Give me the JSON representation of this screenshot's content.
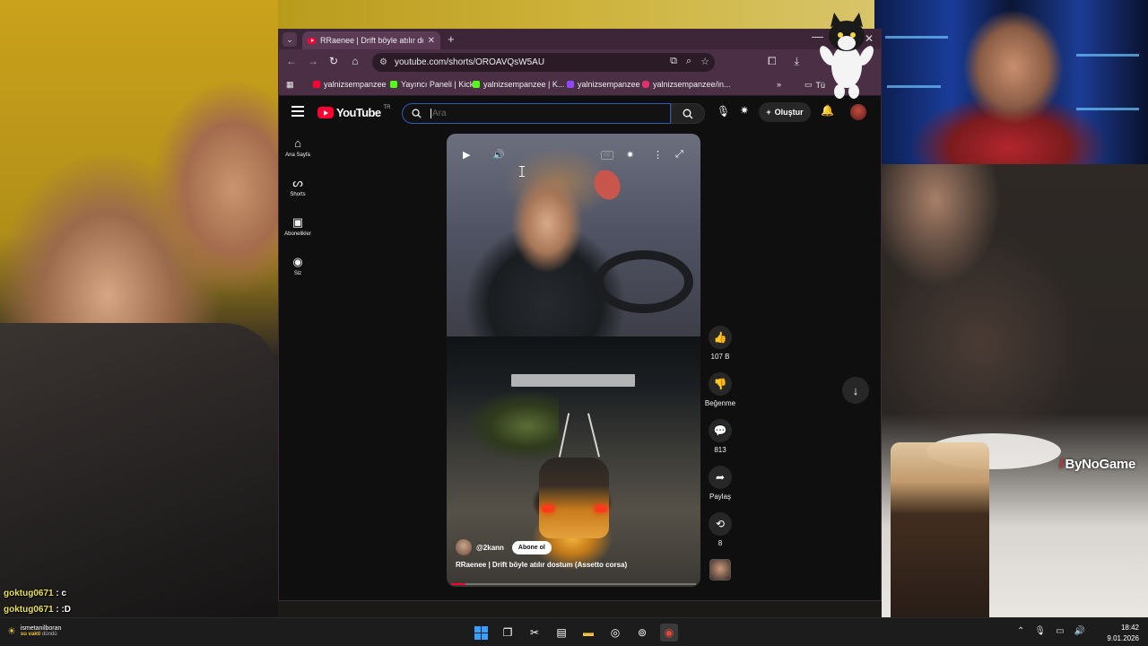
{
  "browser": {
    "tab_title": "RRaenee | Drift böyle atılır dost",
    "url": "youtube.com/shorts/OROAVQsW5AU",
    "bookmarks": [
      {
        "label": "yalnizsempanzee",
        "color": "#ff0033"
      },
      {
        "label": "Yayıncı Paneli | Kick",
        "color": "#53fc18"
      },
      {
        "label": "yalnizsempanzee | K...",
        "color": "#53fc18"
      },
      {
        "label": "yalnizsempanzee",
        "color": "#9146ff"
      },
      {
        "label": "yalnizsempanzee/in...",
        "color": "#e1306c"
      }
    ],
    "bookmark_folder": "Tü"
  },
  "youtube": {
    "logo_text": "YouTube",
    "logo_country": "TR",
    "search_placeholder": "Ara",
    "create_label": "Oluştur",
    "sidebar": [
      {
        "icon": "home-icon",
        "label": "Ana Sayfa"
      },
      {
        "icon": "shorts-icon",
        "label": "Shorts"
      },
      {
        "icon": "subscriptions-icon",
        "label": "Abonelikler"
      },
      {
        "icon": "you-icon",
        "label": "Siz"
      }
    ],
    "short": {
      "channel": "@2kann",
      "subscribe_label": "Abone ol",
      "title": "RRaenee | Drift böyle atılır dostum (Assetto corsa)",
      "progress": 0.06
    },
    "actions": {
      "likes": "107 B",
      "dislike_label": "Beğenme",
      "comments": "813",
      "share_label": "Paylaş",
      "remix_count": "8"
    }
  },
  "stream": {
    "brand": "ByNoGame",
    "chat": [
      {
        "user": "goktug0671",
        "message": ": c"
      },
      {
        "user": "goktug0671",
        "message": ": :D"
      }
    ]
  },
  "taskbar": {
    "notification_user": "ismetanilboran",
    "notification_text_a": "su vakti",
    "notification_text_b": "dündü",
    "time": "18:42",
    "date": "9.01.2026"
  }
}
